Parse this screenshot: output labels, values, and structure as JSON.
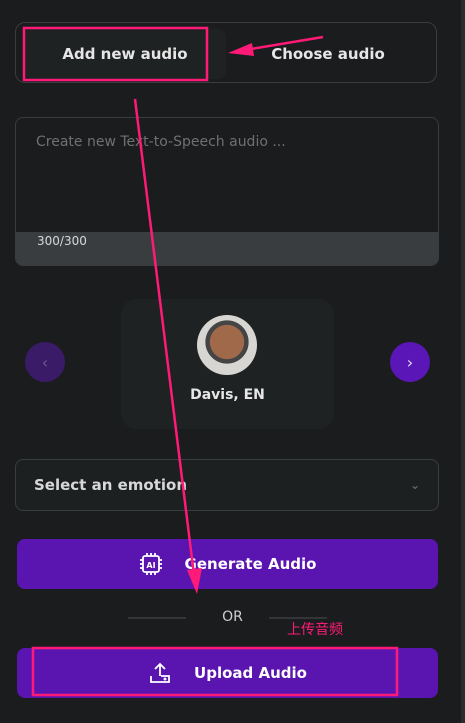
{
  "tabs": [
    {
      "label": "Add new audio",
      "active": true
    },
    {
      "label": "Choose audio",
      "active": false
    }
  ],
  "textarea": {
    "placeholder": "Create new Text-to-Speech audio ...",
    "value": "",
    "counter": "300/300"
  },
  "voice": {
    "name": "Davis, EN",
    "avatar": "avatar-photo"
  },
  "emotion": {
    "placeholder": "Select an emotion",
    "icon": "chevron-down-icon"
  },
  "buttons": {
    "generate": "Generate Audio",
    "generate_icon": "ai-chip-icon",
    "upload": "Upload Audio",
    "upload_icon": "upload-icon"
  },
  "divider": "OR",
  "annotation": {
    "text": "上传音频",
    "color": "#ff1a77"
  },
  "colors": {
    "accent": "#5a14b0",
    "background": "#1b1c1e"
  }
}
